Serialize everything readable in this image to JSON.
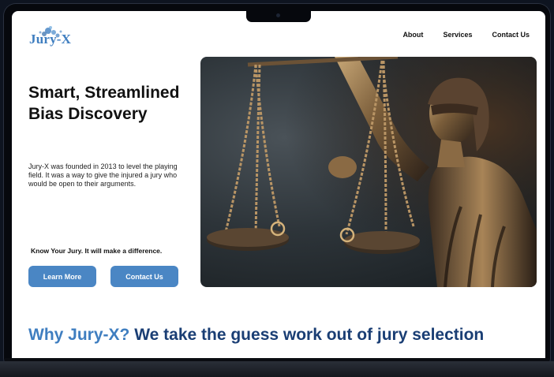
{
  "brand": {
    "logo_text": "Jury-X",
    "accent": "#3f7ec0",
    "dark_blue": "#1a3e74",
    "button_color": "#4a86c4"
  },
  "nav": {
    "items": [
      {
        "label": "About"
      },
      {
        "label": "Services"
      },
      {
        "label": "Contact Us"
      }
    ]
  },
  "hero": {
    "title": "Smart, Streamlined Bias Discovery",
    "description": "Jury-X was founded in 2013 to level the playing field. It was a way to give the injured a jury who would be open to their arguments.",
    "tagline": "Know Your Jury. It will make a difference.",
    "primary_button": "Learn More",
    "secondary_button": "Contact Us",
    "image_subject": "lady-justice-statue-with-scales"
  },
  "section": {
    "heading_part1": "Why Jury-X?",
    "heading_part2": "We take the guess work out of jury selection"
  }
}
